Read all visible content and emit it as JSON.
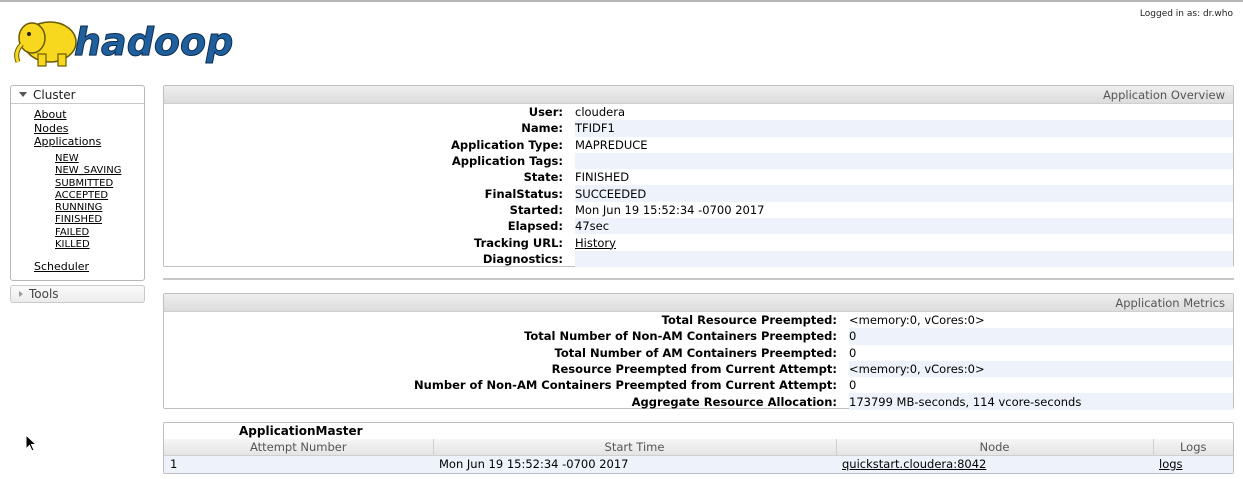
{
  "header": {
    "logo_text": "hadoop",
    "logged_in": "Logged in as: dr.who"
  },
  "nav": {
    "cluster_label": "Cluster",
    "items": [
      "About",
      "Nodes",
      "Applications"
    ],
    "app_states": [
      "NEW",
      "NEW_SAVING",
      "SUBMITTED",
      "ACCEPTED",
      "RUNNING",
      "FINISHED",
      "FAILED",
      "KILLED"
    ],
    "scheduler_label": "Scheduler",
    "tools_label": "Tools"
  },
  "overview": {
    "title": "Application Overview",
    "rows": [
      {
        "label": "User:",
        "value": "cloudera"
      },
      {
        "label": "Name:",
        "value": "TFIDF1"
      },
      {
        "label": "Application Type:",
        "value": "MAPREDUCE"
      },
      {
        "label": "Application Tags:",
        "value": ""
      },
      {
        "label": "State:",
        "value": "FINISHED"
      },
      {
        "label": "FinalStatus:",
        "value": "SUCCEEDED"
      },
      {
        "label": "Started:",
        "value": "Mon Jun 19 15:52:34 -0700 2017"
      },
      {
        "label": "Elapsed:",
        "value": "47sec"
      },
      {
        "label": "Tracking URL:",
        "value": "History",
        "link": true
      },
      {
        "label": "Diagnostics:",
        "value": ""
      }
    ]
  },
  "metrics": {
    "title": "Application Metrics",
    "rows": [
      {
        "label": "Total Resource Preempted:",
        "value": "<memory:0, vCores:0>"
      },
      {
        "label": "Total Number of Non-AM Containers Preempted:",
        "value": "0"
      },
      {
        "label": "Total Number of AM Containers Preempted:",
        "value": "0"
      },
      {
        "label": "Resource Preempted from Current Attempt:",
        "value": "<memory:0, vCores:0>"
      },
      {
        "label": "Number of Non-AM Containers Preempted from Current Attempt:",
        "value": "0"
      },
      {
        "label": "Aggregate Resource Allocation:",
        "value": "173799 MB-seconds, 114 vcore-seconds"
      }
    ]
  },
  "am": {
    "title": "ApplicationMaster",
    "columns": [
      "Attempt Number",
      "Start Time",
      "Node",
      "Logs"
    ],
    "row": {
      "attempt": "1",
      "start": "Mon Jun 19 15:52:34 -0700 2017",
      "node": "quickstart.cloudera:8042",
      "logs": "logs"
    }
  },
  "colors": {
    "row_alt": "#eef3fb",
    "elephant": "#f7d81e",
    "logo_text": "#1f5f9e"
  }
}
